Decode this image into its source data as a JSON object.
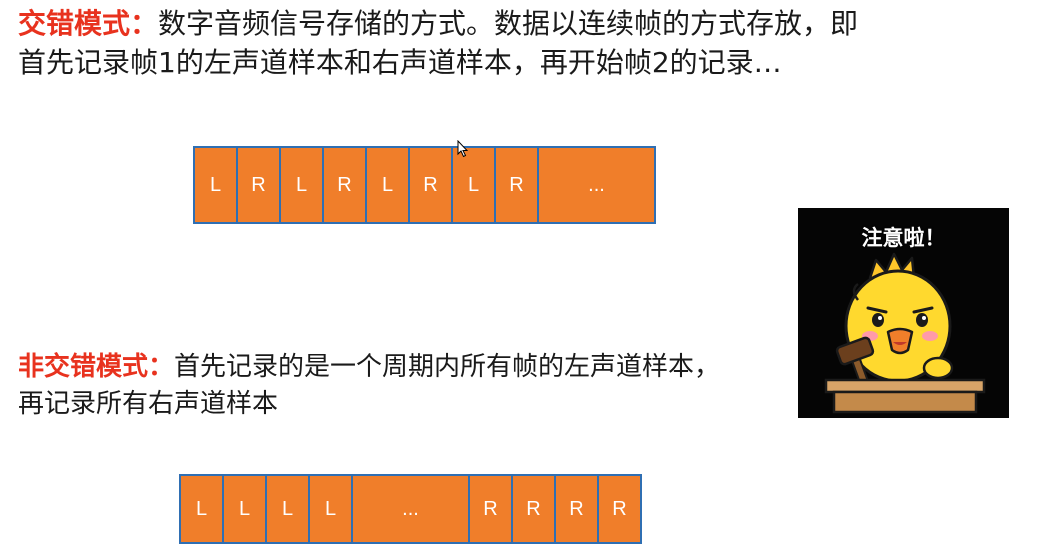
{
  "interleaved": {
    "term": "交错模式：",
    "description": "数字音频信号存储的方式。数据以连续帧的方式存放，即首先记录帧1的左声道样本和右声道样本，再开始帧2的记录…",
    "cells": [
      "L",
      "R",
      "L",
      "R",
      "L",
      "R",
      "L",
      "R",
      "..."
    ]
  },
  "non_interleaved": {
    "term": "非交错模式：",
    "description": "首先记录的是一个周期内所有帧的左声道样本，再记录所有右声道样本",
    "cells": [
      "L",
      "L",
      "L",
      "L",
      "...",
      "R",
      "R",
      "R",
      "R"
    ]
  },
  "sticker": {
    "caption": "注意啦！",
    "icon": "chick-judge-gavel-icon"
  },
  "colors": {
    "term": "#e8321e",
    "cell_fill": "#f07e2a",
    "cell_border": "#2f6fb3"
  }
}
